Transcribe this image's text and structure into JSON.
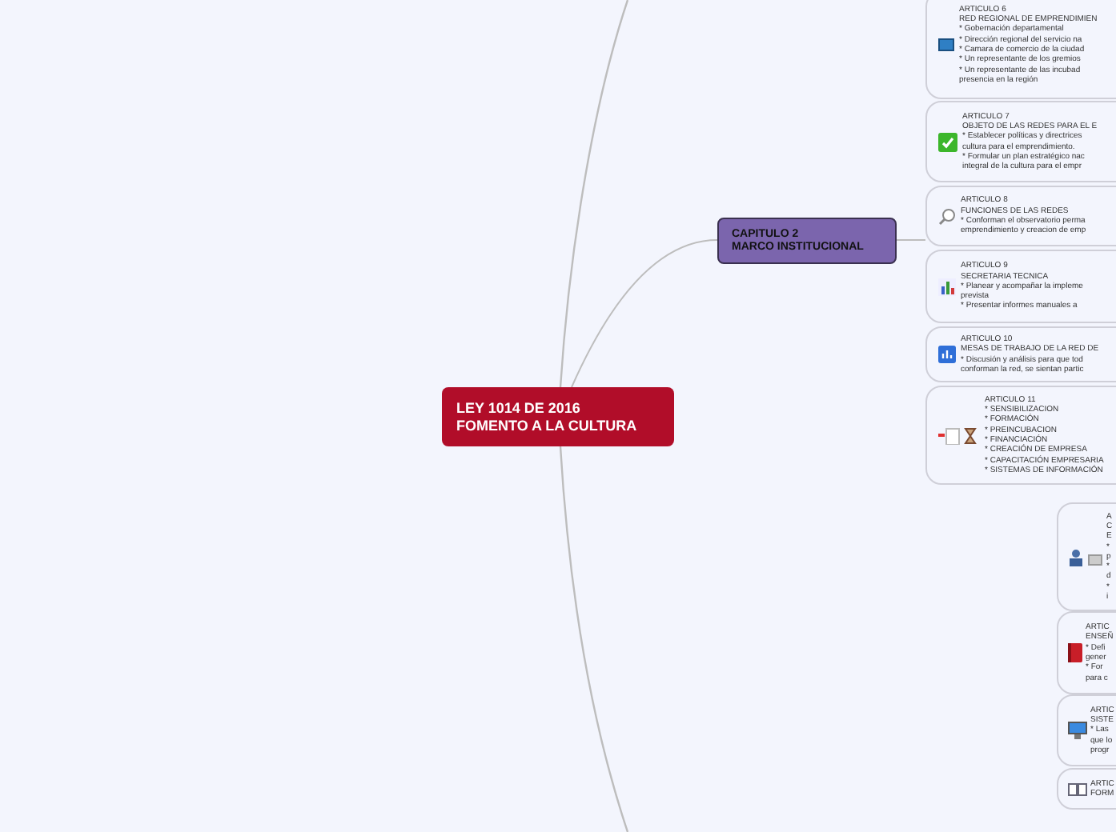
{
  "root": {
    "lines": [
      "LEY 1014 DE 2016",
      "FOMENTO A LA CULTURA"
    ]
  },
  "chapter": {
    "lines": [
      "CAPITULO 2",
      "MARCO INSTITUCIONAL"
    ],
    "articles": [
      {
        "lines": [
          "ARTICULO 6",
          "RED REGIONAL DE EMPRENDIMIEN",
          "* Gobernación departamental",
          "* Dirección regional del servicio na",
          "* Camara de comercio de la ciudad",
          "* Un representante de los gremios",
          "* Un representante de las incubad",
          "presencia en la región"
        ]
      },
      {
        "lines": [
          "ARTICULO 7",
          "OBJETO DE LAS REDES PARA EL E",
          "* Establecer políticas y directrices",
          "cultura para el emprendimiento.",
          "* Formular un plan estratégico nac",
          "integral de la cultura para el empr"
        ]
      },
      {
        "lines": [
          "ARTICULO 8",
          "FUNCIONES DE LAS REDES",
          "* Conforman el observatorio perma",
          "emprendimiento y creacion de emp"
        ]
      },
      {
        "lines": [
          "ARTICULO 9",
          "SECRETARIA TECNICA",
          "* Planear y acompañar la impleme",
          "prevista",
          "* Presentar informes manuales a"
        ]
      },
      {
        "lines": [
          "ARTICULO 10",
          "MESAS DE TRABAJO DE LA RED DE",
          "* Discusión y análisis para que tod",
          "conforman la red, se sientan partic"
        ]
      },
      {
        "lines": [
          "ARTICULO 11",
          "* SENSIBILIZACION",
          "* FORMACIÓN",
          "* PREINCUBACION",
          "* FINANCIACIÓN",
          "* CREACIÓN DE EMPRESA",
          "* CAPACITACIÓN EMPRESARIA",
          "* SISTEMAS DE INFORMACIÓN"
        ]
      }
    ]
  },
  "lower_articles": [
    {
      "lines": [
        "A",
        "C",
        "E",
        "*",
        "p",
        "*",
        "d",
        "*",
        "i"
      ]
    },
    {
      "lines": [
        "ARTIC",
        "ENSEÑ",
        "* Defi",
        "gener",
        "* For",
        "para c"
      ]
    },
    {
      "lines": [
        "ARTIC",
        "SISTE",
        "* Las",
        "que lo",
        "progr"
      ]
    },
    {
      "lines": [
        "ARTIC",
        "FORM"
      ]
    }
  ]
}
